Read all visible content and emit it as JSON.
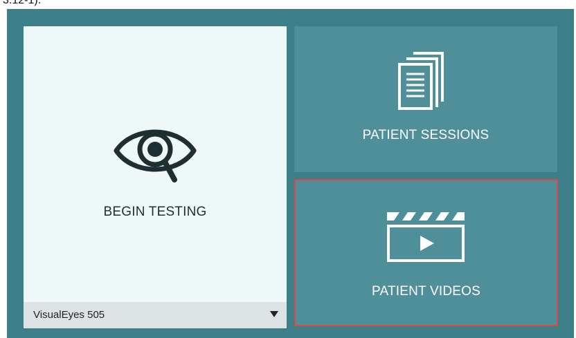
{
  "caption": {
    "text": "3.12-1)."
  },
  "tiles": {
    "begin_testing": {
      "label": "BEGIN TESTING",
      "icon": "eye-magnifier-icon"
    },
    "patient_sessions": {
      "label": "PATIENT SESSIONS",
      "icon": "documents-icon"
    },
    "patient_videos": {
      "label": "PATIENT VIDEOS",
      "icon": "clapperboard-icon",
      "highlighted": true
    }
  },
  "device_select": {
    "value": "VisualEyes 505",
    "icon": "chevron-down-icon"
  },
  "colors": {
    "panel": "#3d7f88",
    "tile_dark": "#4f8f9a",
    "tile_light": "#eef8f9",
    "highlight_border": "#e04848"
  }
}
